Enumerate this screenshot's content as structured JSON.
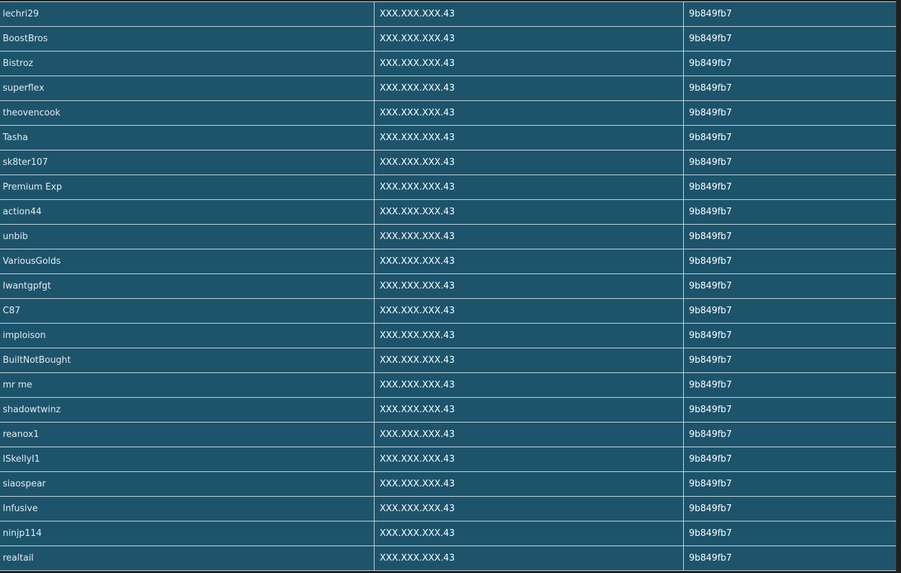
{
  "rows": [
    {
      "username": "lechri29",
      "ip": "XXX.XXX.XXX.43",
      "hash": "9b849fb7"
    },
    {
      "username": "BoostBros",
      "ip": "XXX.XXX.XXX.43",
      "hash": "9b849fb7"
    },
    {
      "username": "Bistroz",
      "ip": "XXX.XXX.XXX.43",
      "hash": "9b849fb7"
    },
    {
      "username": "superflex",
      "ip": "XXX.XXX.XXX.43",
      "hash": "9b849fb7"
    },
    {
      "username": "theovencook",
      "ip": "XXX.XXX.XXX.43",
      "hash": "9b849fb7"
    },
    {
      "username": "Tasha",
      "ip": "XXX.XXX.XXX.43",
      "hash": "9b849fb7"
    },
    {
      "username": "sk8ter107",
      "ip": "XXX.XXX.XXX.43",
      "hash": "9b849fb7"
    },
    {
      "username": "Premium Exp",
      "ip": "XXX.XXX.XXX.43",
      "hash": "9b849fb7"
    },
    {
      "username": "action44",
      "ip": "XXX.XXX.XXX.43",
      "hash": "9b849fb7"
    },
    {
      "username": "unbib",
      "ip": "XXX.XXX.XXX.43",
      "hash": "9b849fb7"
    },
    {
      "username": "VariousGolds",
      "ip": "XXX.XXX.XXX.43",
      "hash": "9b849fb7"
    },
    {
      "username": "Iwantgpfgt",
      "ip": "XXX.XXX.XXX.43",
      "hash": "9b849fb7"
    },
    {
      "username": "C87",
      "ip": "XXX.XXX.XXX.43",
      "hash": "9b849fb7"
    },
    {
      "username": "imploison",
      "ip": "XXX.XXX.XXX.43",
      "hash": "9b849fb7"
    },
    {
      "username": "BuiltNotBought",
      "ip": "XXX.XXX.XXX.43",
      "hash": "9b849fb7"
    },
    {
      "username": "mr me",
      "ip": "XXX.XXX.XXX.43",
      "hash": "9b849fb7"
    },
    {
      "username": "shadowtwinz",
      "ip": "XXX.XXX.XXX.43",
      "hash": "9b849fb7"
    },
    {
      "username": "reanox1",
      "ip": "XXX.XXX.XXX.43",
      "hash": "9b849fb7"
    },
    {
      "username": "ISkellyI1",
      "ip": "XXX.XXX.XXX.43",
      "hash": "9b849fb7"
    },
    {
      "username": "siaospear",
      "ip": "XXX.XXX.XXX.43",
      "hash": "9b849fb7"
    },
    {
      "username": "Infusive",
      "ip": "XXX.XXX.XXX.43",
      "hash": "9b849fb7"
    },
    {
      "username": "ninjp114",
      "ip": "XXX.XXX.XXX.43",
      "hash": "9b849fb7"
    },
    {
      "username": "realtail",
      "ip": "XXX.XXX.XXX.43",
      "hash": "9b849fb7"
    }
  ]
}
